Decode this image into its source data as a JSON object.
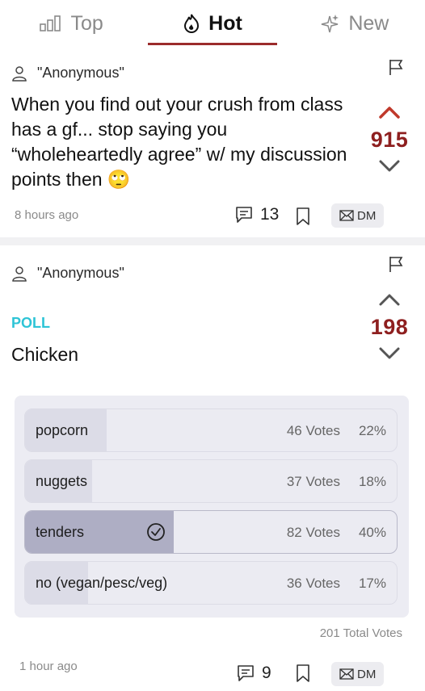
{
  "tabs": [
    {
      "label": "Top",
      "icon": "bar-chart-icon",
      "active": false
    },
    {
      "label": "Hot",
      "icon": "flame-icon",
      "active": true
    },
    {
      "label": "New",
      "icon": "sparkle-icon",
      "active": false
    }
  ],
  "posts": [
    {
      "author": "\"Anonymous\"",
      "text": "When you find out your crush from class has a gf... stop saying you “wholeheartedly agree” w/ my discussion points then 🙄",
      "score": "915",
      "time": "8 hours ago",
      "comments": "13",
      "dm_label": "DM"
    },
    {
      "author": "\"Anonymous\"",
      "poll_label": "POLL",
      "question": "Chicken",
      "score": "198",
      "options": [
        {
          "label": "popcorn",
          "votes": "46 Votes",
          "pct": "22%",
          "fraction": 0.22,
          "selected": false
        },
        {
          "label": "nuggets",
          "votes": "37 Votes",
          "pct": "18%",
          "fraction": 0.18,
          "selected": false
        },
        {
          "label": "tenders",
          "votes": "82 Votes",
          "pct": "40%",
          "fraction": 0.4,
          "selected": true
        },
        {
          "label": "no (vegan/pesc/veg)",
          "votes": "36 Votes",
          "pct": "17%",
          "fraction": 0.17,
          "selected": false
        }
      ],
      "total_votes": "201 Total Votes",
      "time": "1 hour ago",
      "comments": "9",
      "dm_label": "DM"
    }
  ],
  "colors": {
    "accent": "#9b2b2b",
    "score": "#8e1f1f",
    "poll": "#2ec4d6"
  }
}
